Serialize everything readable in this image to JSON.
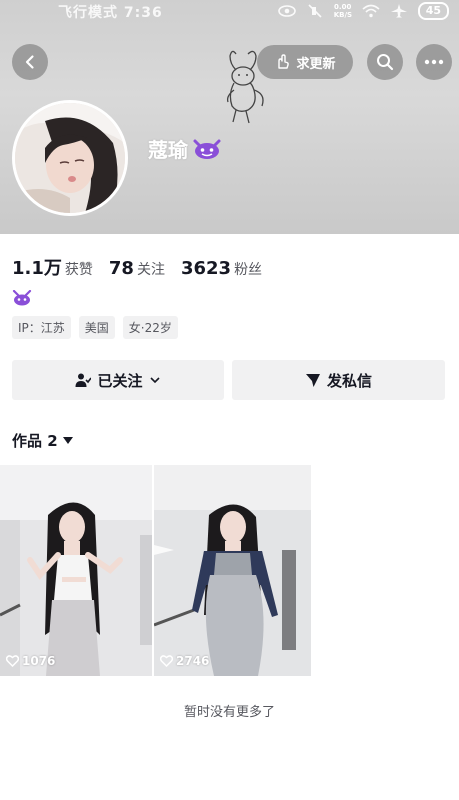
{
  "status_bar": {
    "left_text": "飞行模式 7:36",
    "net_speed": "0.00 KB/S",
    "battery": "45"
  },
  "header": {
    "update_button_label": "求更新",
    "nickname": "蔻瑜"
  },
  "profile": {
    "stats": [
      {
        "value": "1.1万",
        "label": "获赞"
      },
      {
        "value": "78",
        "label": "关注"
      },
      {
        "value": "3623",
        "label": "粉丝"
      }
    ],
    "tags": [
      "IP：江苏",
      "美国",
      "女·22岁"
    ]
  },
  "actions": {
    "followed_label": "已关注",
    "message_label": "发私信"
  },
  "works": {
    "title": "作品 2",
    "items": [
      {
        "likes": "1076"
      },
      {
        "likes": "2746"
      }
    ]
  },
  "footer": {
    "end_text": "暂时没有更多了"
  },
  "colors": {
    "header_bg": "#cfcfcf",
    "text_primary": "#161823",
    "text_secondary": "#57585f",
    "button_bg": "#f1f1f2",
    "badge_purple": "#8a4fd8"
  }
}
